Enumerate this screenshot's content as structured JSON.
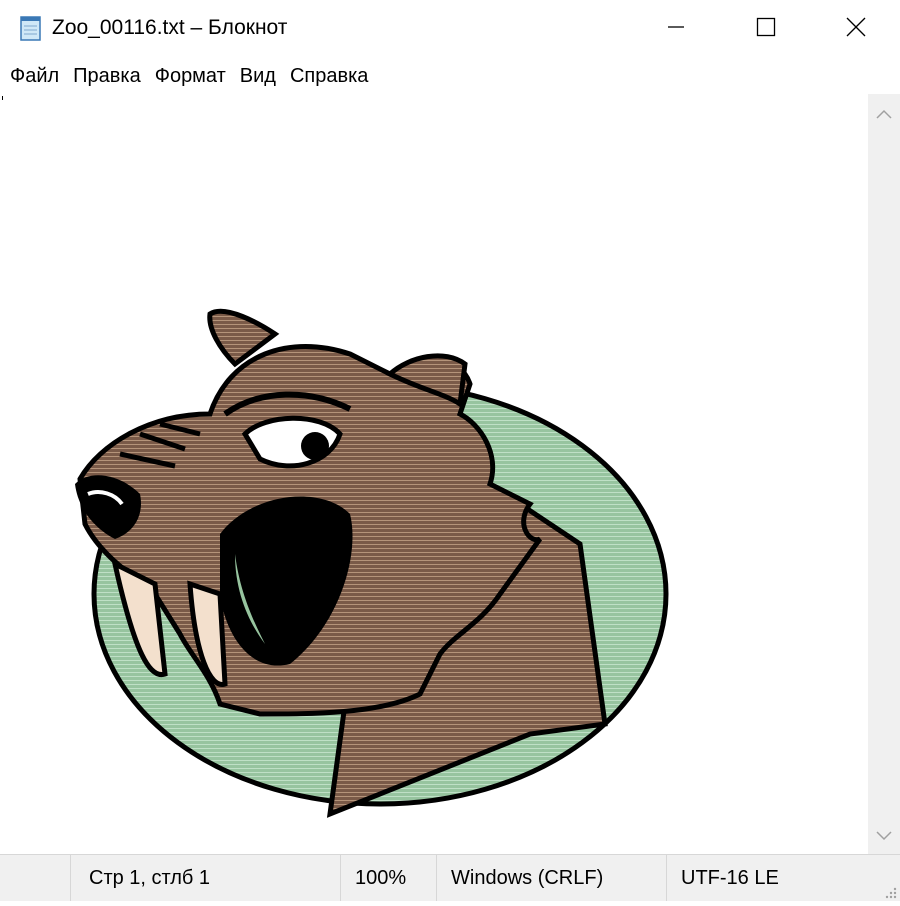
{
  "window": {
    "title": "Zoo_00116.txt – Блокнот",
    "icon": "notepad-icon",
    "controls": [
      "minimize-icon",
      "maximize-icon",
      "close-icon"
    ]
  },
  "menu": {
    "items": [
      "Файл",
      "Правка",
      "Формат",
      "Вид",
      "Справка"
    ]
  },
  "editor": {
    "content_description_icon": "beaver-ascii-art",
    "colors": {
      "fur": "#7a5a48",
      "fur_stripe": "#b5947a",
      "background_oval": "#97c49f",
      "outline": "#000000",
      "teeth": "#f3e0cd"
    }
  },
  "scrollbar": {
    "up_icon": "chevron-up-icon",
    "down_icon": "chevron-down-icon"
  },
  "status": {
    "position": "Стр 1, стлб 1",
    "zoom": "100%",
    "line_endings": "Windows (CRLF)",
    "encoding": "UTF-16 LE"
  }
}
